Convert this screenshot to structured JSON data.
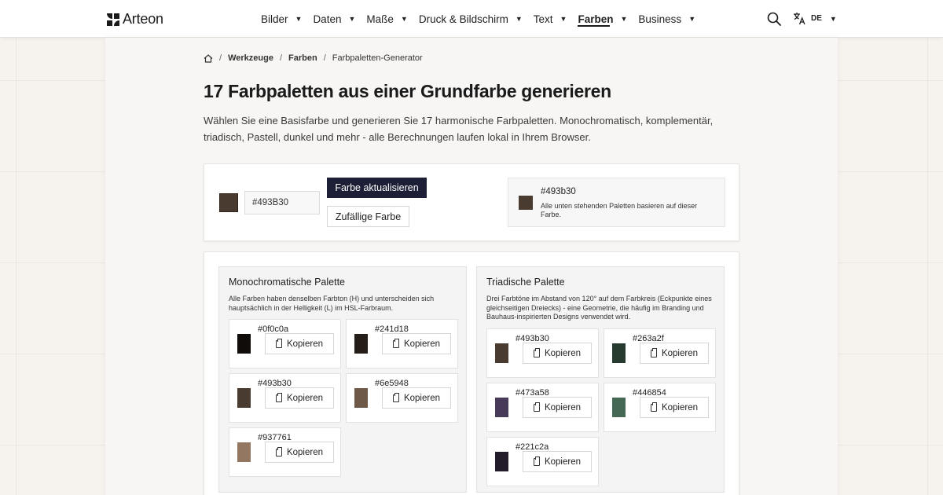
{
  "header": {
    "brand": "Arteon",
    "nav": [
      {
        "label": "Bilder",
        "active": false
      },
      {
        "label": "Daten",
        "active": false
      },
      {
        "label": "Maße",
        "active": false
      },
      {
        "label": "Druck & Bildschirm",
        "active": false
      },
      {
        "label": "Text",
        "active": false
      },
      {
        "label": "Farben",
        "active": true
      },
      {
        "label": "Business",
        "active": false
      }
    ],
    "search_icon": "search-icon",
    "language_icon": "translate-icon",
    "language": "DE"
  },
  "breadcrumb": {
    "home_icon": "home-icon",
    "items": [
      "Werkzeuge",
      "Farben",
      "Farbpaletten-Generator"
    ]
  },
  "page": {
    "title": "17 Farbpaletten aus einer Grundfarbe generieren",
    "intro": "Wählen Sie eine Basisfarbe und generieren Sie 17 harmonische Farbpaletten. Monochromatisch, komplementär, triadisch, Pastell, dunkel und mehr - alle Berechnungen laufen lokal in Ihrem Browser."
  },
  "picker": {
    "swatch_color": "#493b30",
    "input_value": "#493B30",
    "update_button": "Farbe aktualisieren",
    "random_button": "Zufällige Farbe",
    "base_hex": "#493b30",
    "base_note": "Alle unten stehenden Paletten basieren auf dieser Farbe."
  },
  "copy_label": "Kopieren",
  "palettes": {
    "mono": {
      "title": "Monochromatische Palette",
      "description": "Alle Farben haben denselben Farbton (H) und unterscheiden sich hauptsächlich in der Helligkeit (L) im HSL-Farbraum.",
      "colors": [
        "#0f0c0a",
        "#241d18",
        "#493b30",
        "#6e5948",
        "#937761"
      ]
    },
    "tri": {
      "title": "Triadische Palette",
      "description": "Drei Farbtöne im Abstand von 120° auf dem Farbkreis (Eckpunkte eines gleichseitigen Dreiecks) - eine Geometrie, die häufig im Branding und Bauhaus-inspirierten Designs verwendet wird.",
      "colors": [
        "#493b30",
        "#263a2f",
        "#473a58",
        "#446854",
        "#221c2a"
      ]
    }
  }
}
